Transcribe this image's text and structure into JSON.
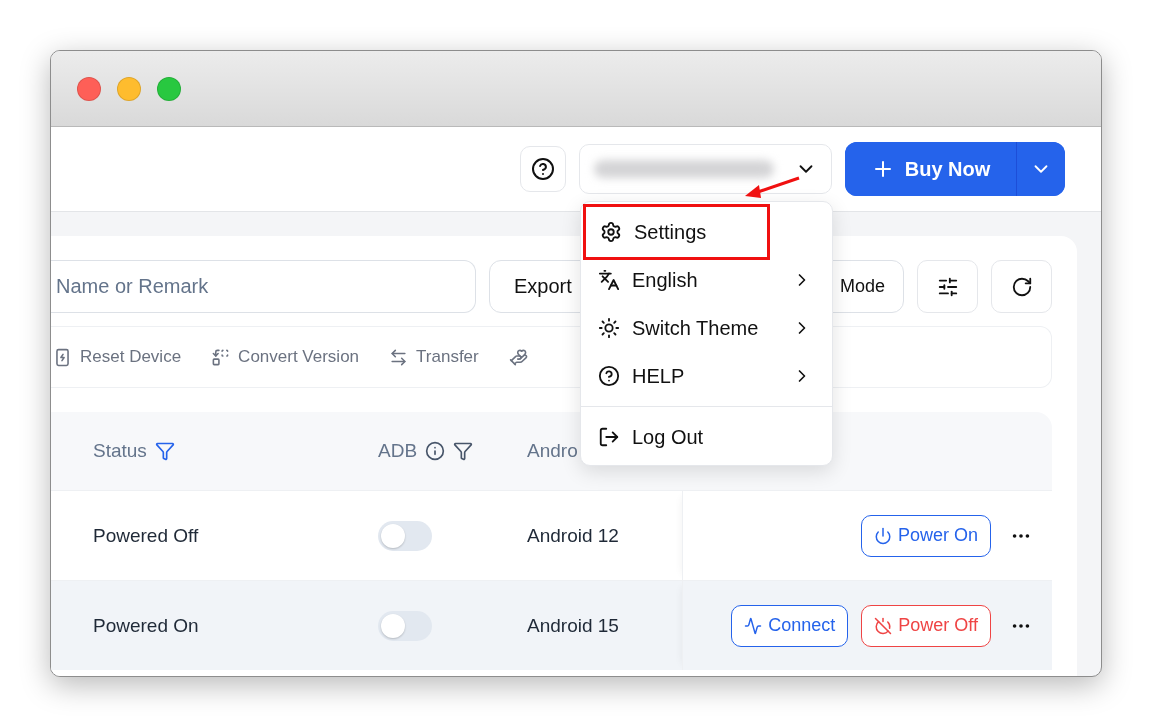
{
  "header": {
    "buy_button": {
      "label": "Buy Now"
    }
  },
  "search": {
    "placeholder": "Name or Remark"
  },
  "toolbar_buttons": [
    {
      "label": "Export"
    },
    {
      "label": "Mode"
    }
  ],
  "actions": [
    {
      "kind": "reset",
      "label": "Reset Device"
    },
    {
      "kind": "convert",
      "label": "Convert Version"
    },
    {
      "kind": "transfer",
      "label": "Transfer"
    },
    {
      "kind": "hand"
    }
  ],
  "table": {
    "columns": [
      {
        "label": "Status",
        "kind": "filter_active"
      },
      {
        "label": "ADB",
        "kind": "info_filter"
      },
      {
        "label": "Andro",
        "kind": "plain"
      }
    ],
    "rows": [
      {
        "status": "Powered Off",
        "adb_on": false,
        "android": "Android 12",
        "hovered": false,
        "buttons": [
          {
            "kind": "power_on",
            "label": "Power On"
          }
        ]
      },
      {
        "status": "Powered On",
        "adb_on": false,
        "android": "Android 15",
        "hovered": true,
        "buttons": [
          {
            "kind": "connect",
            "label": "Connect"
          },
          {
            "kind": "power_off",
            "label": "Power Off"
          }
        ]
      }
    ]
  },
  "menu": {
    "items": [
      {
        "kind": "settings",
        "label": "Settings",
        "submenu": false,
        "annotated": true
      },
      {
        "kind": "language",
        "label": "English",
        "submenu": true,
        "annotated": false
      },
      {
        "kind": "theme",
        "label": "Switch Theme",
        "submenu": true,
        "annotated": false
      },
      {
        "kind": "help",
        "label": "HELP",
        "submenu": true,
        "annotated": false
      },
      {
        "kind": "logout",
        "label": "Log Out",
        "submenu": false,
        "annotated": false
      }
    ]
  }
}
